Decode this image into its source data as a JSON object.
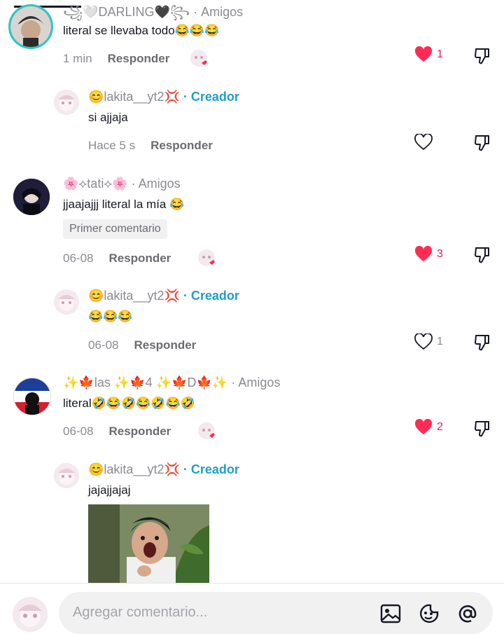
{
  "comments": [
    {
      "username_partial": "꧁🤍DARLING🖤꧂",
      "relation": "· Amigos",
      "text": "literal se llevaba todo😂😂😂",
      "time": "1 min",
      "reply_label": "Responder",
      "likes": "1",
      "liked": true
    },
    {
      "username": "😊lakita__yt2💢",
      "role": "· Creador",
      "text": "si ajjaja",
      "time": "Hace 5 s",
      "reply_label": "Responder",
      "likes": "",
      "liked": false
    },
    {
      "username": "🌸⟡tati⟡🌸",
      "relation": "· Amigos",
      "text": "jjaajajjj literal la mía 😂",
      "badge": "Primer comentario",
      "time": "06-08",
      "reply_label": "Responder",
      "likes": "3",
      "liked": true
    },
    {
      "username": "😊lakita__yt2💢",
      "role": "· Creador",
      "text": "😂😂😂",
      "time": "06-08",
      "reply_label": "Responder",
      "likes": "1",
      "liked": false
    },
    {
      "username": "✨🍁las ✨🍁4 ✨🍁D🍁✨",
      "relation": "· Amigos",
      "text": "literal🤣😂🤣😂🤣😂🤣",
      "time": "06-08",
      "reply_label": "Responder",
      "likes": "2",
      "liked": true
    },
    {
      "username": "😊lakita__yt2💢",
      "role": "· Creador",
      "text": "jajajjajaj",
      "has_gif": true
    }
  ],
  "footer": {
    "placeholder": "Agregar comentario...",
    "icons": [
      "image-icon",
      "emoji-icon",
      "mention-icon"
    ]
  },
  "colors": {
    "liked": "#fe2c55",
    "creator": "#20a0c4",
    "muted": "#8a8b91"
  }
}
